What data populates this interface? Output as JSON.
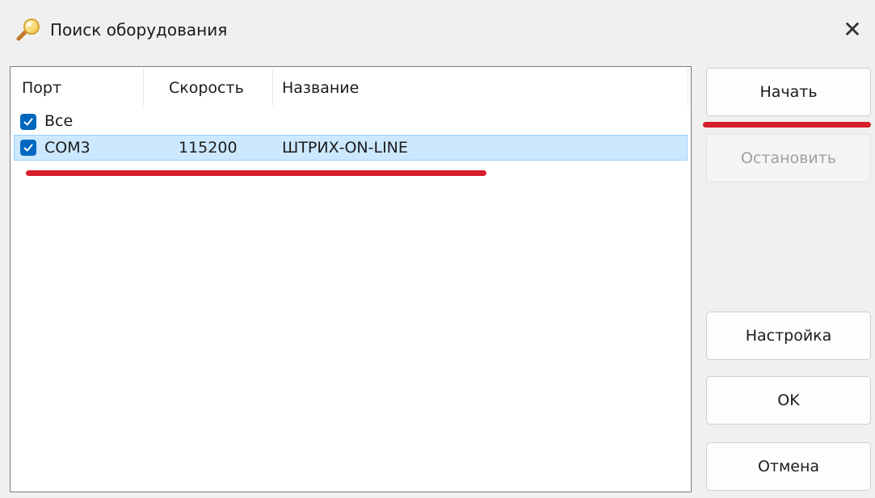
{
  "window": {
    "title": "Поиск оборудования",
    "close_glyph": "✕"
  },
  "list": {
    "columns": [
      "Порт",
      "Скорость",
      "Название"
    ],
    "rows": [
      {
        "port": "Все",
        "speed": "",
        "name": "",
        "checked": true,
        "selected": false
      },
      {
        "port": "COM3",
        "speed": "115200",
        "name": "ШТРИХ-ON-LINE",
        "checked": true,
        "selected": true
      }
    ]
  },
  "buttons": {
    "start": "Начать",
    "stop": "Остановить",
    "settings": "Настройка",
    "ok": "OK",
    "cancel": "Отмена"
  },
  "colors": {
    "accent": "#0067c0",
    "selection": "#cce8ff",
    "annotation": "#d51f2a"
  },
  "icons": {
    "title": "magnifier-icon",
    "checkbox": "checkmark-icon",
    "close": "close-icon"
  }
}
